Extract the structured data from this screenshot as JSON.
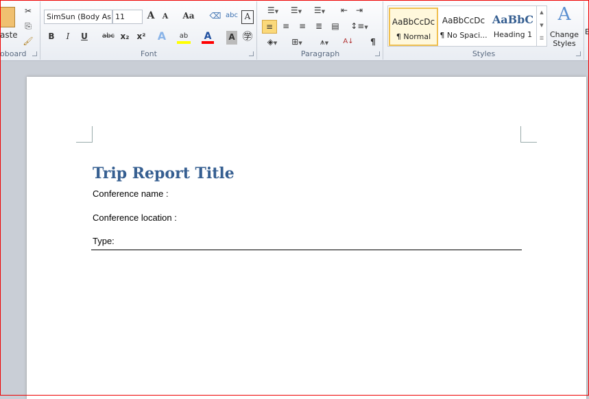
{
  "ribbon": {
    "clipboard": {
      "label": "oboard",
      "paste": "aste"
    },
    "font": {
      "label": "Font",
      "font_name": "SimSun (Body As",
      "font_size": "11",
      "change_case": "Aa",
      "bold": "B",
      "italic": "I",
      "underline": "U",
      "strike": "abc",
      "subscript": "x₂",
      "superscript": "x²",
      "highlight_color": "#ffff00",
      "font_color": "#ff0000"
    },
    "paragraph": {
      "label": "Paragraph",
      "pilcrow": "¶"
    },
    "styles": {
      "label": "Styles",
      "items": [
        {
          "preview": "AaBbCcDc",
          "name": "¶ Normal",
          "selected": true
        },
        {
          "preview": "AaBbCcDc",
          "name": "¶ No Spaci..."
        },
        {
          "preview": "AaBbC",
          "name": "Heading 1"
        }
      ],
      "change_styles": "Change Styles"
    },
    "editing_partial": "E"
  },
  "document": {
    "title": "Trip Report Title",
    "lines": [
      "Conference name :",
      "Conference location :",
      "Type:"
    ],
    "title_color": "#365f91"
  }
}
